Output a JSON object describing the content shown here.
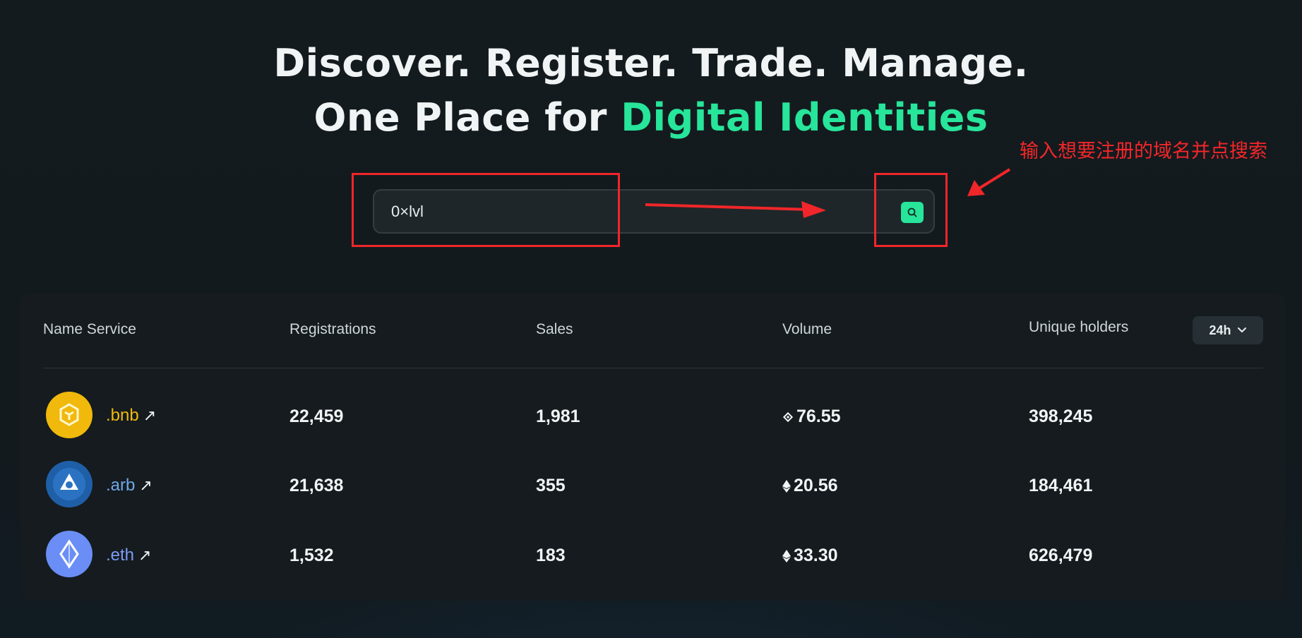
{
  "hero": {
    "line1": "Discover. Register. Trade. Manage.",
    "line2_prefix": "One Place for ",
    "line2_accent": "Digital Identities"
  },
  "search": {
    "value": "0×lvl",
    "button_icon": "search-icon"
  },
  "annotation": {
    "text": "输入想要注册的域名并点搜索"
  },
  "table": {
    "columns": [
      "Name Service",
      "Registrations",
      "Sales",
      "Volume",
      "Unique holders"
    ],
    "period": "24h",
    "rows": [
      {
        "name": ".bnb",
        "registrations": "22,459",
        "sales": "1,981",
        "volume": "76.55",
        "holders": "398,245",
        "logo": "bnb-logo-icon",
        "currency_icon": "bnb-diamond-icon",
        "name_color": "#f0b90b"
      },
      {
        "name": ".arb",
        "registrations": "21,638",
        "sales": "355",
        "volume": "20.56",
        "holders": "184,461",
        "logo": "arb-logo-icon",
        "currency_icon": "eth-icon",
        "name_color": "#6fa8e8"
      },
      {
        "name": ".eth",
        "registrations": "1,532",
        "sales": "183",
        "volume": "33.30",
        "holders": "626,479",
        "logo": "eth-logo-icon",
        "currency_icon": "eth-icon",
        "name_color": "#7d9cf7"
      }
    ]
  },
  "colors": {
    "accent": "#27e59a",
    "annotation": "#f0262a",
    "background": "#131a1d"
  }
}
